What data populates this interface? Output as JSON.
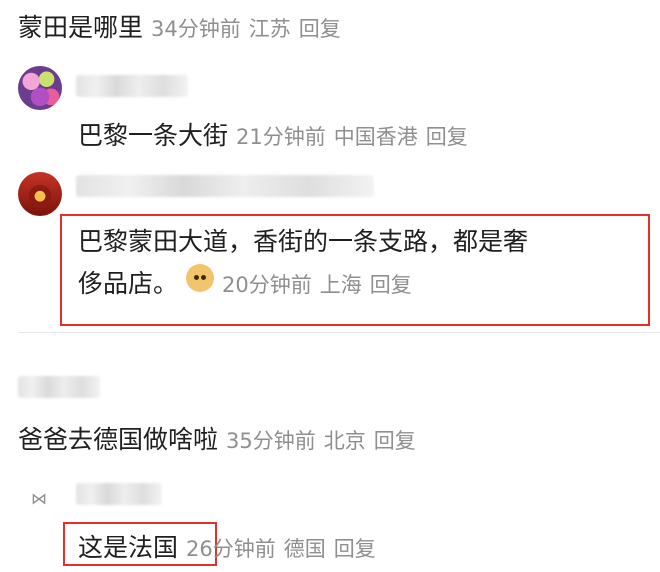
{
  "comments": [
    {
      "text": "蒙田是哪里",
      "time": "34分钟前",
      "location": "江苏",
      "reply": "回复"
    },
    {
      "text": "巴黎一条大街",
      "time": "21分钟前",
      "location": "中国香港",
      "reply": "回复"
    },
    {
      "text_line1": "巴黎蒙田大道，香街的一条支路，都是奢",
      "text_line2": "侈品店。",
      "time": "20分钟前",
      "location": "上海",
      "reply": "回复"
    },
    {
      "text": "爸爸去德国做啥啦",
      "time": "35分钟前",
      "location": "北京",
      "reply": "回复"
    },
    {
      "text": "这是法国",
      "time": "26分钟前",
      "location": "德国",
      "reply": "回复"
    }
  ],
  "colors": {
    "highlight": "#e0322a",
    "meta": "#8f8f8f",
    "text": "#1f1f1f"
  },
  "icons": {
    "emoji": "smiling-dog-emoji",
    "small_avatar": "bow-icon"
  }
}
